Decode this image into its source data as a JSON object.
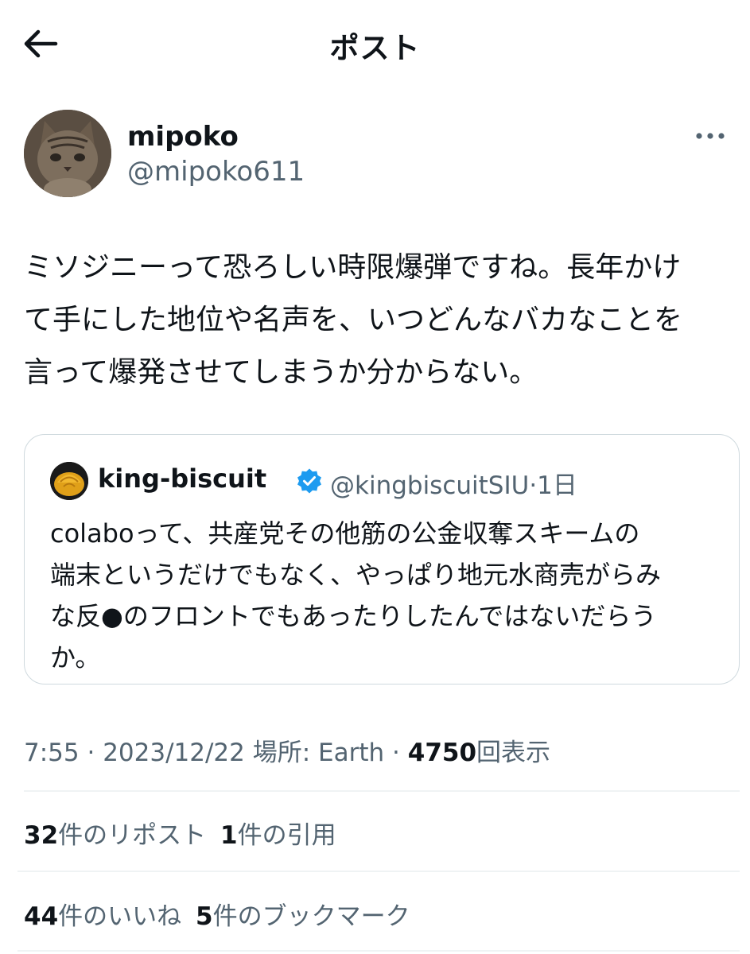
{
  "header": {
    "title": "ポスト"
  },
  "author": {
    "name": "mipoko",
    "handle": "@mipoko611"
  },
  "post": {
    "text": "ミソジニーって恐ろしい時限爆弾ですね。長年かけ\nて手にした地位や名声を、いつどんなバカなことを\n言って爆発させてしまうか分からない。"
  },
  "quote": {
    "name": "king-biscuit",
    "handle": "@kingbiscuitSIU",
    "separator": "·",
    "time": "1日",
    "text": "colaboって、共産党その他筋の公金収奪スキームの\n端末というだけでもなく、やっぱり地元水商売がらみ\nな反●のフロントでもあったりしたんではないだらう\nか。"
  },
  "meta": {
    "time": "7:55",
    "sep1": "·",
    "date": "2023/12/22",
    "location": "場所: Earth",
    "sep2": "·",
    "views_count": "4750",
    "views_label": "回表示"
  },
  "stats": {
    "reposts_count": "32",
    "reposts_label": "件のリポスト",
    "quotes_count": "1",
    "quotes_label": "件の引用",
    "likes_count": "44",
    "likes_label": "件のいいね",
    "bookmarks_count": "5",
    "bookmarks_label": "件のブックマーク"
  },
  "icons": {
    "back": "arrow-left-icon",
    "more": "ellipsis-icon",
    "verified": "verified-badge-icon"
  },
  "colors": {
    "text": "#0f1419",
    "secondary": "#536471",
    "verified": "#1d9bf0",
    "border": "#cfd9de"
  }
}
